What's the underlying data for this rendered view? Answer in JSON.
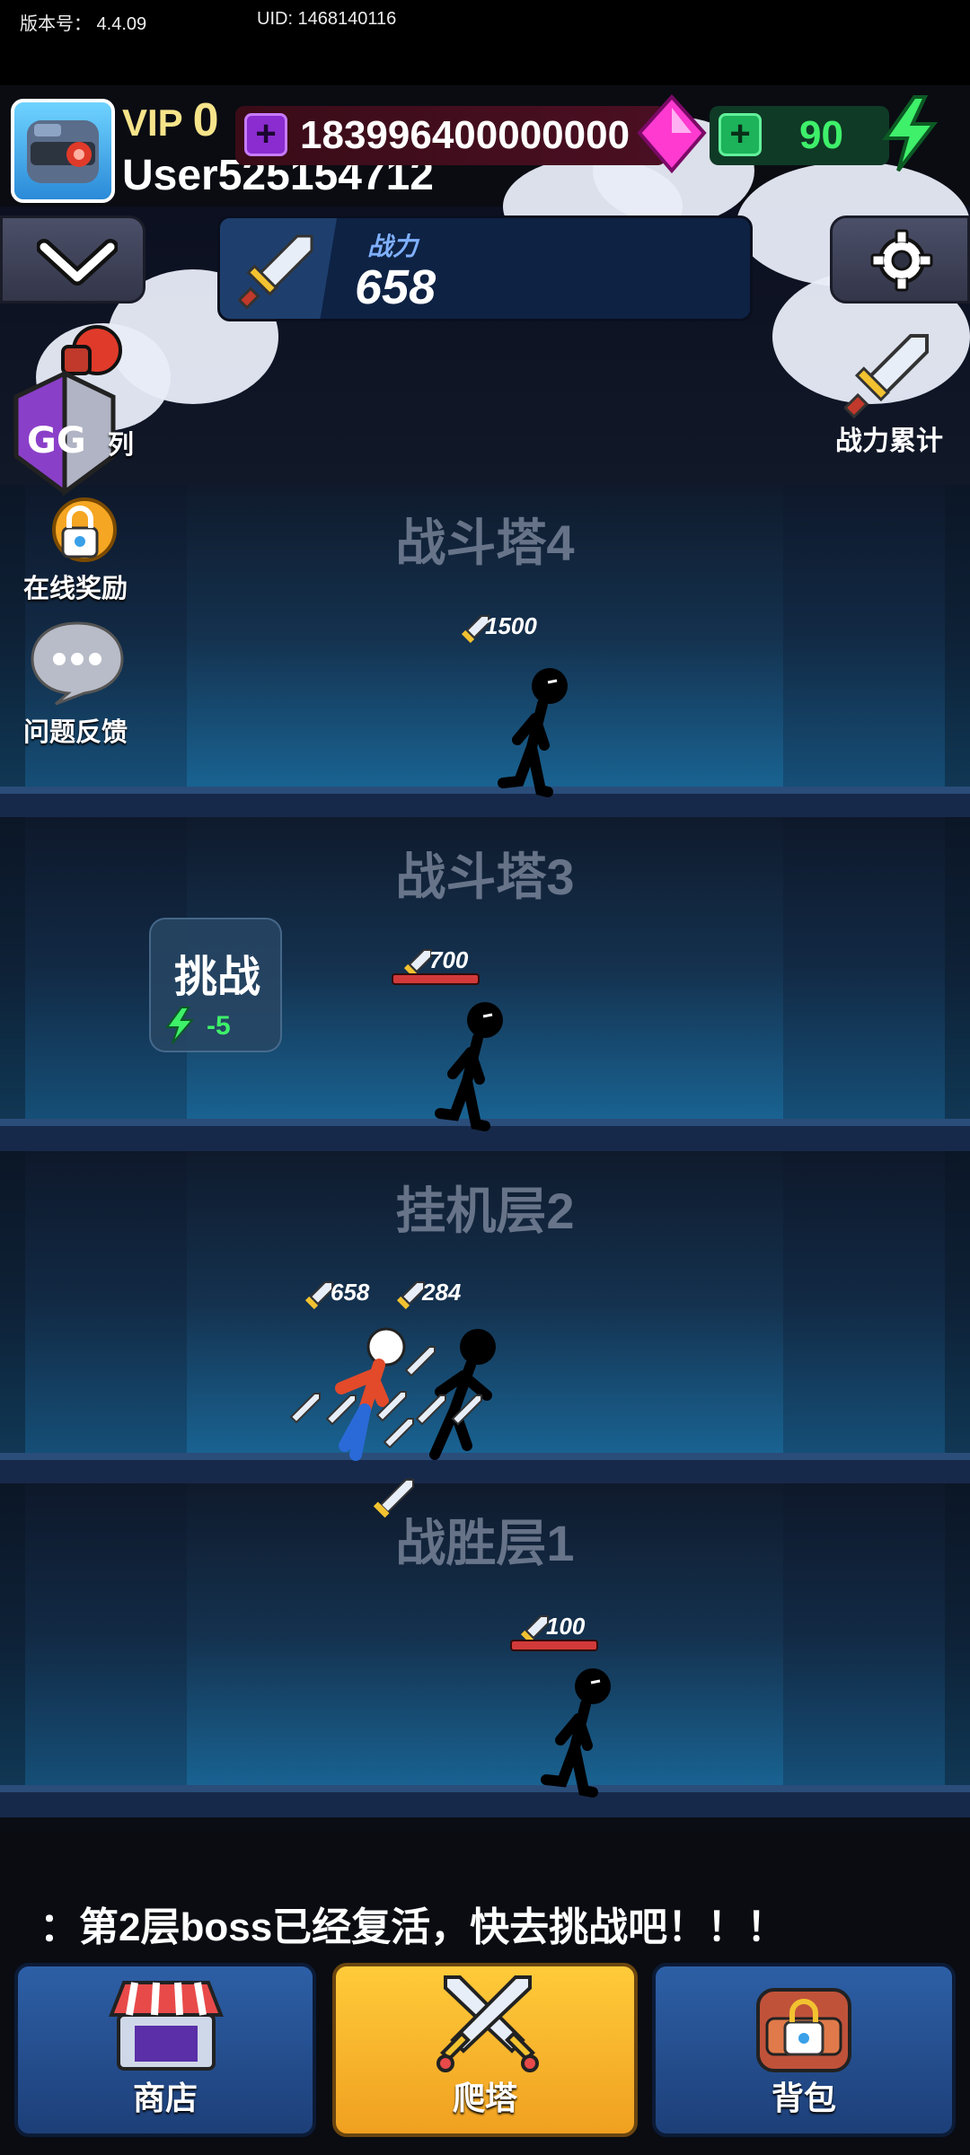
{
  "status": {
    "version_label": "版本号： 4.4.09",
    "uid_label": "UID: 1468140116"
  },
  "profile": {
    "vip_label": "VIP",
    "vip_level": "0",
    "username": "User525154712"
  },
  "currency": {
    "gems": "183996400000000",
    "energy": "90"
  },
  "power": {
    "label": "战力",
    "value": "658"
  },
  "right_menu": {
    "accum_label": "战力累计"
  },
  "left_menu": {
    "partial_label": "列",
    "gg_label": "GG",
    "online_reward": "在线奖励",
    "feedback": "问题反馈"
  },
  "floors": [
    {
      "title": "战斗塔4",
      "enemy_power": "1500"
    },
    {
      "title": "战斗塔3",
      "enemy_power": "700"
    },
    {
      "title": "挂机层2",
      "player_power": "658",
      "enemy_power": "284"
    },
    {
      "title": "战胜层1",
      "enemy_power": "100"
    }
  ],
  "challenge": {
    "label": "挑战",
    "cost": "-5"
  },
  "marquee": "：第2层boss已经复活，快去挑战吧！！！",
  "nav": {
    "shop": "商店",
    "tower": "爬塔",
    "bag": "背包"
  },
  "colors": {
    "energy_green": "#3ef06a",
    "gem_pink": "#ff3ad0",
    "tower_active": "#f0a020"
  }
}
